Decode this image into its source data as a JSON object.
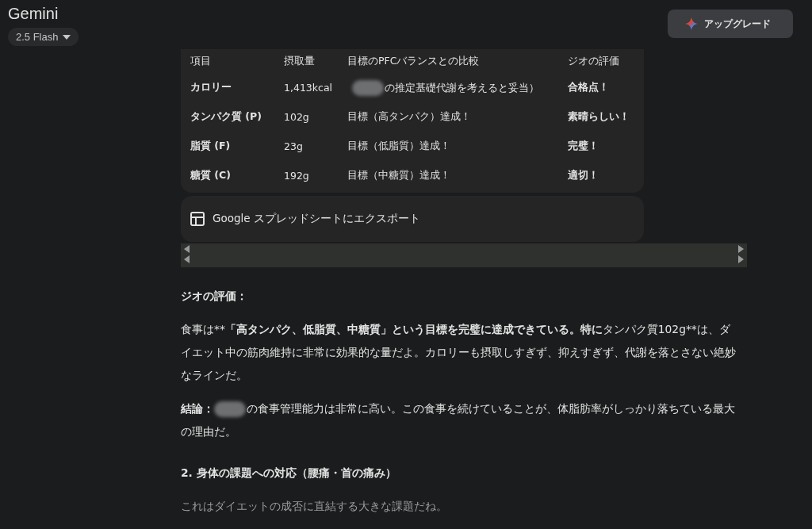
{
  "app_title": "Gemini",
  "model_picker": {
    "label": "2.5 Flash"
  },
  "upgrade_button": {
    "label": "アップグレード"
  },
  "table": {
    "columns": [
      "項目",
      "摂取量",
      "目標のPFCバランスとの比較",
      "ジオの評価"
    ],
    "rows": [
      {
        "item": "カロリー",
        "amount": "1,413kcal",
        "comparison": {
          "redacted": true,
          "text": "の推定基礎代謝を考えると妥当）"
        },
        "rating": "合格点！"
      },
      {
        "item": "タンパク質 (P)",
        "amount": "102g",
        "comparison": {
          "redacted": false,
          "text": "目標（高タンパク）達成！"
        },
        "rating": "素晴らしい！"
      },
      {
        "item": "脂質 (F)",
        "amount": "23g",
        "comparison": {
          "redacted": false,
          "text": "目標（低脂質）達成！"
        },
        "rating": "完璧！"
      },
      {
        "item": "糖質 (C)",
        "amount": "192g",
        "comparison": {
          "redacted": false,
          "text": "目標（中糖質）達成！"
        },
        "rating": "適切！"
      }
    ],
    "export_button": {
      "label": "Google スプレッドシートにエクスポート"
    }
  },
  "blocks": [
    {
      "kind": "heading",
      "segments": [
        {
          "kind": "bold",
          "text": "ジオの評価："
        }
      ]
    },
    {
      "kind": "paragraph",
      "segments": [
        {
          "kind": "text",
          "text": "食事は**"
        },
        {
          "kind": "bold",
          "text": "「高タンパク、低脂質、中糖質」という目標を完璧に達成できている。特に"
        },
        {
          "kind": "text",
          "text": "タンパク質102g**は、ダイエット中の筋肉維持に非常に効果的な量だよ。カロリーも摂取しすぎず、抑えすぎず、代謝を落とさない絶妙なラインだ。"
        }
      ]
    },
    {
      "kind": "paragraph",
      "segments": [
        {
          "kind": "bold",
          "text": "結論："
        },
        {
          "kind": "redaction"
        },
        {
          "kind": "text",
          "text": "の食事管理能力は非常に高い。この食事を続けていることが、体脂肪率がしっかり落ちている最大の理由だ。"
        }
      ]
    },
    {
      "kind": "section_heading",
      "segments": [
        {
          "kind": "bold",
          "text": "2. 身体の課題への対応（腰痛・首の痛み）"
        }
      ]
    },
    {
      "kind": "faded",
      "segments": [
        {
          "kind": "text",
          "text": "これはダイエットの成否に直結する大きな課題だね。"
        }
      ]
    }
  ]
}
